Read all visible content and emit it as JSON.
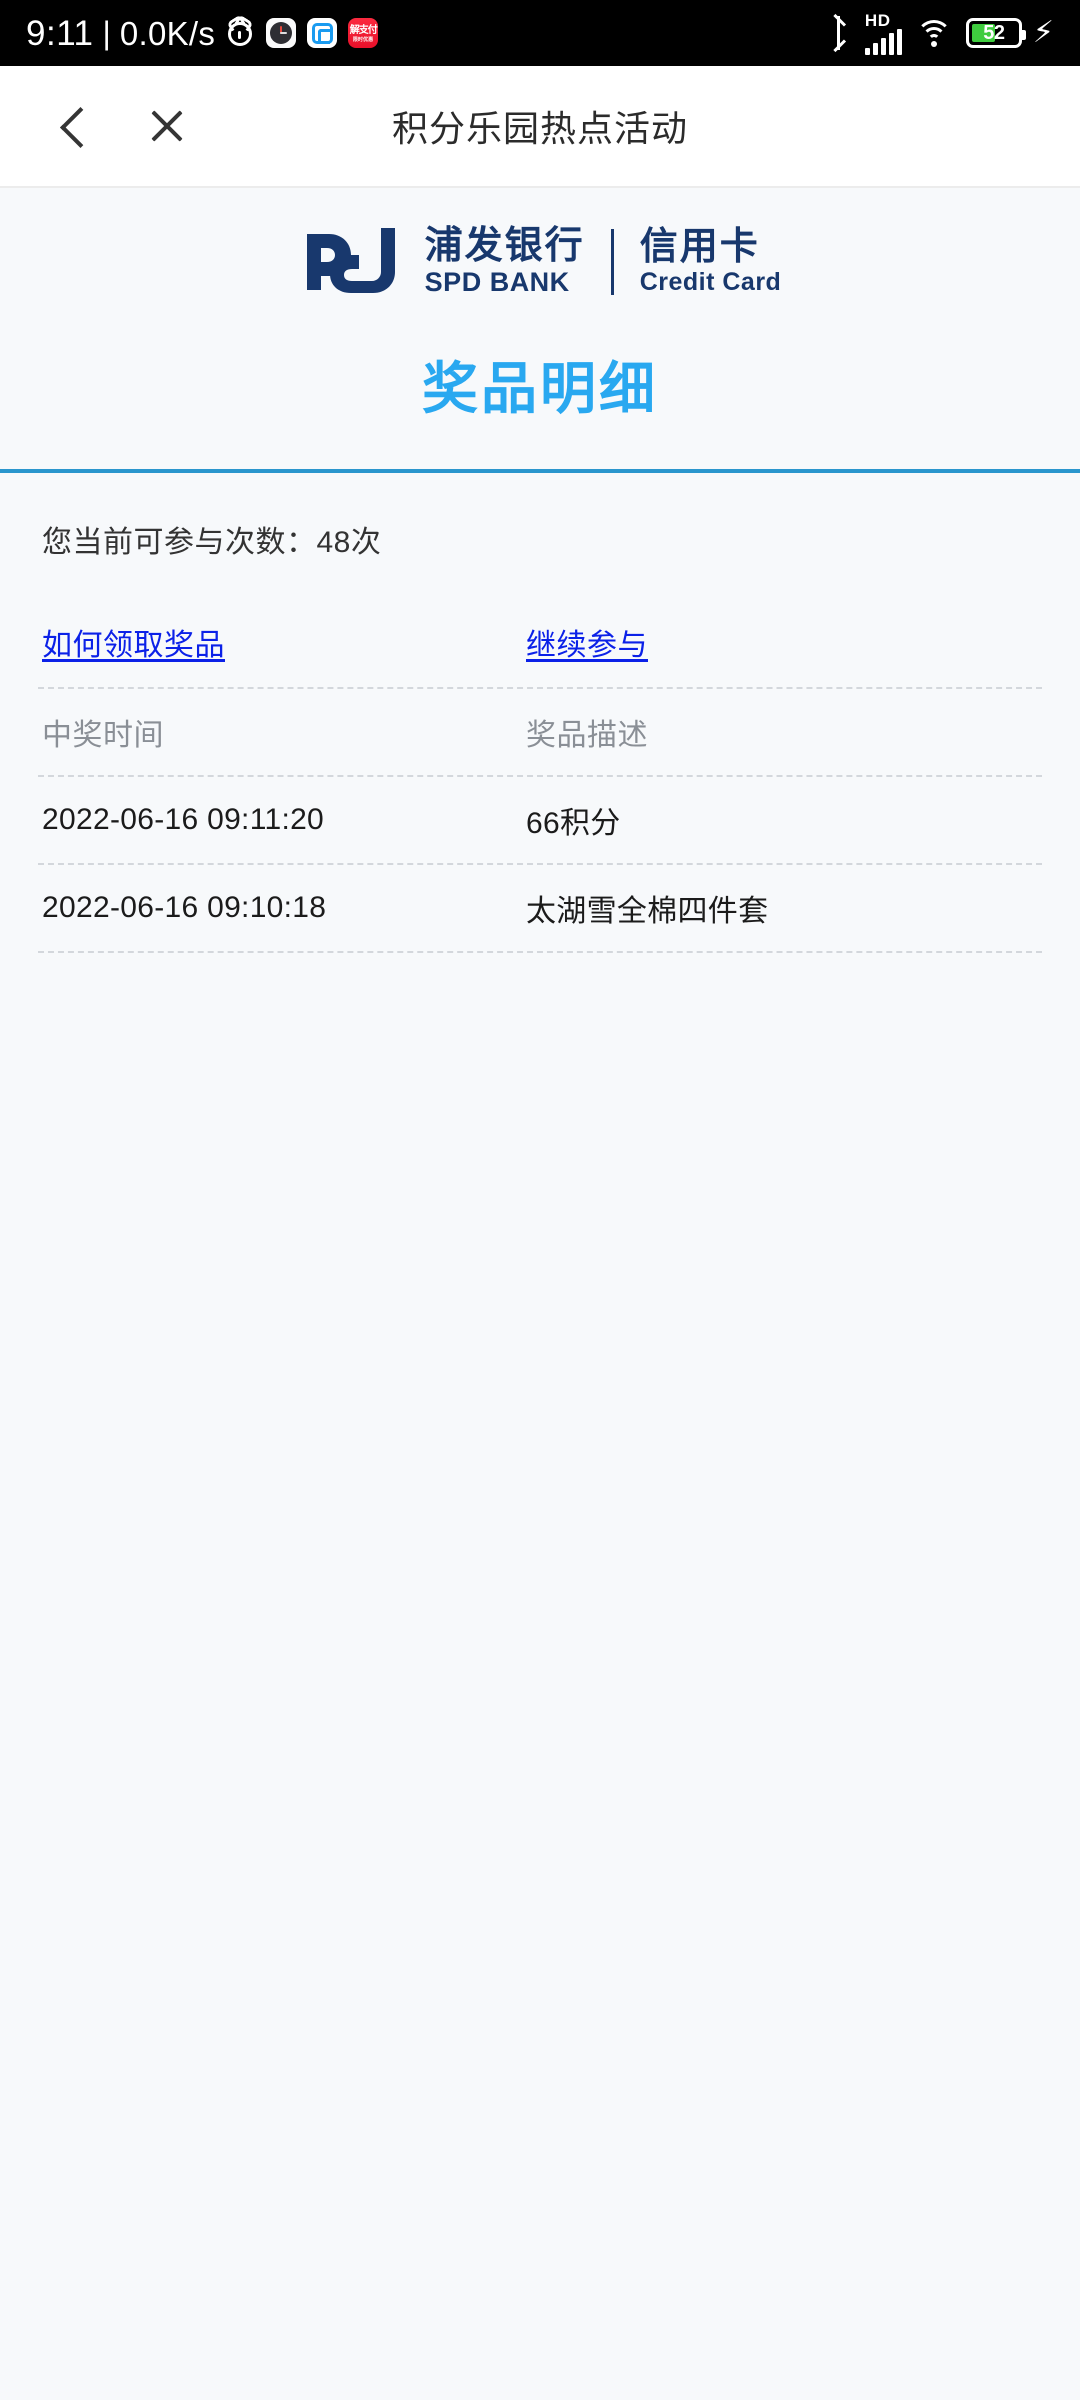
{
  "status_bar": {
    "time": "9:11",
    "separator": "|",
    "network_speed": "0.0K/s",
    "left_icons": [
      "alarm-clock-icon",
      "clock-app-icon",
      "blue-app-icon",
      "red-app-icon"
    ],
    "red_app_line1": "解支付",
    "red_app_line2": "限时优惠",
    "volte_label": "HD",
    "battery_percent": "52",
    "battery_level": 52,
    "charging": true,
    "right_icons": [
      "bluetooth-icon",
      "volte-hd-icon",
      "signal-bars-icon",
      "wifi-icon",
      "battery-icon",
      "charging-bolt-icon"
    ]
  },
  "navbar": {
    "back_icon": "chevron-left-icon",
    "close_icon": "close-x-icon",
    "title": "积分乐园热点活动"
  },
  "brand": {
    "logo_mark": "spd-pd-logomark",
    "bank_cn": "浦发银行",
    "bank_en": "SPD BANK",
    "product_cn": "信用卡",
    "product_en": "Credit Card",
    "brand_color": "#18386d"
  },
  "page": {
    "title": "奖品明细",
    "title_color": "#29a8f0",
    "rule_color": "#2a96cd",
    "participation_text": "您当前可参与次数：48次",
    "participation_count": "48"
  },
  "links": {
    "how_to_claim": "如何领取奖品",
    "continue": "继续参与",
    "link_color": "#0b21e8"
  },
  "table": {
    "headers": {
      "time": "中奖时间",
      "prize": "奖品描述"
    },
    "rows": [
      {
        "time": "2022-06-16 09:11:20",
        "prize": "66积分"
      },
      {
        "time": "2022-06-16 09:10:18",
        "prize": "太湖雪全棉四件套"
      }
    ]
  }
}
